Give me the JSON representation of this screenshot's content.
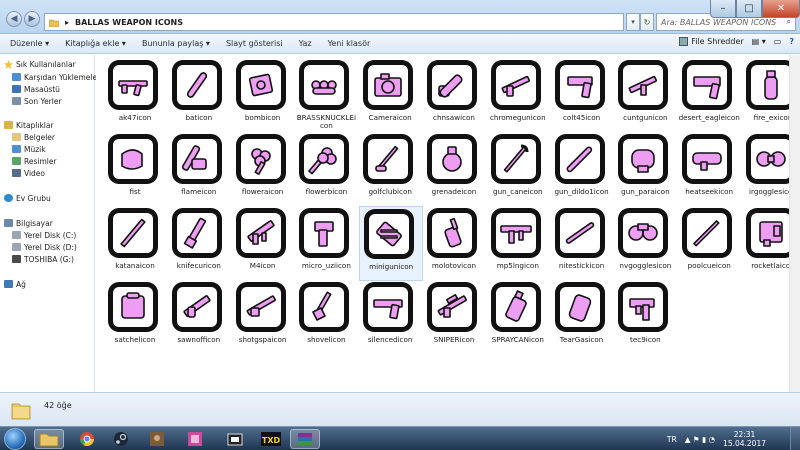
{
  "window": {
    "minimize_glyph": "–",
    "maximize_glyph": "□",
    "close_glyph": "✕"
  },
  "nav_buttons": {
    "back_glyph": "◀",
    "forward_glyph": "▶"
  },
  "address": {
    "arrow_glyph": "▸",
    "crumb": "BALLAS WEAPON ICONS",
    "chevron": "▾",
    "refresh_glyph": "↻"
  },
  "search": {
    "placeholder": "Ara: BALLAS WEAPON ICONS",
    "icon_glyph": "⌕"
  },
  "toolbar": {
    "organize": "Düzenle ▾",
    "add_library": "Kitaplığa ekle ▾",
    "share": "Bununla paylaş ▾",
    "slideshow": "Slayt gösterisi",
    "burn": "Yaz",
    "new_folder": "Yeni klasör",
    "file_shredder": "File Shredder",
    "view_glyph": "▤ ▾",
    "preview_glyph": "▭",
    "help_glyph": "?"
  },
  "nav": {
    "favorites_header": "Sık Kullanılanlar",
    "favorites": [
      "Karşıdan Yüklemeler",
      "Masaüstü",
      "Son Yerler"
    ],
    "libraries_header": "Kitaplıklar",
    "libraries": [
      "Belgeler",
      "Müzik",
      "Resimler",
      "Video"
    ],
    "homegroup": "Ev Grubu",
    "computer_header": "Bilgisayar",
    "drives": [
      "Yerel Disk (C:)",
      "Yerel Disk (D:)",
      "TOSHIBA (G:)"
    ],
    "network": "Ağ"
  },
  "files": [
    "ak47icon",
    "baticon",
    "bombicon",
    "BRASSKNUCKLEicon",
    "Cameraicon",
    "chnsawicon",
    "chromegunicon",
    "colt45icon",
    "cuntgunicon",
    "desert_eagleicon",
    "fire_exicon",
    "fist",
    "flameicon",
    "floweraicon",
    "flowerbicon",
    "golfclubicon",
    "grenadeicon",
    "gun_caneicon",
    "gun_dildo1icon",
    "gun_paraicon",
    "heatseekicon",
    "irgogglesicon",
    "katanaicon",
    "knifecuricon",
    "M4icon",
    "micro_uziicon",
    "minigunicon",
    "molotovicon",
    "mp5lngicon",
    "nitestickicon",
    "nvgogglesicon",
    "poolcueicon",
    "rocketlaicon",
    "satchelicon",
    "sawnofficon",
    "shotgspaicon",
    "shovelicon",
    "silencedicon",
    "SNIPERicon",
    "SPRAYCANicon",
    "TearGasicon",
    "tec9icon"
  ],
  "selected_file": "minigunicon",
  "status": {
    "item_count": "42 öğe"
  },
  "taskbar": {
    "apps": [
      "Windows Gezgini",
      "Google Chrome",
      "Steam",
      "GTA San Andreas",
      "Oyun",
      "Kamera",
      "TXD Workshop",
      "WinRAR"
    ],
    "language": "TR",
    "tray_glyphs": "▲ ⚑ ▮ ◔",
    "time": "22:31",
    "date": "15.04.2017"
  },
  "colors": {
    "icon_pink": "#ee9ef2",
    "icon_outline": "#111111",
    "selection": "#e8f2fc"
  }
}
